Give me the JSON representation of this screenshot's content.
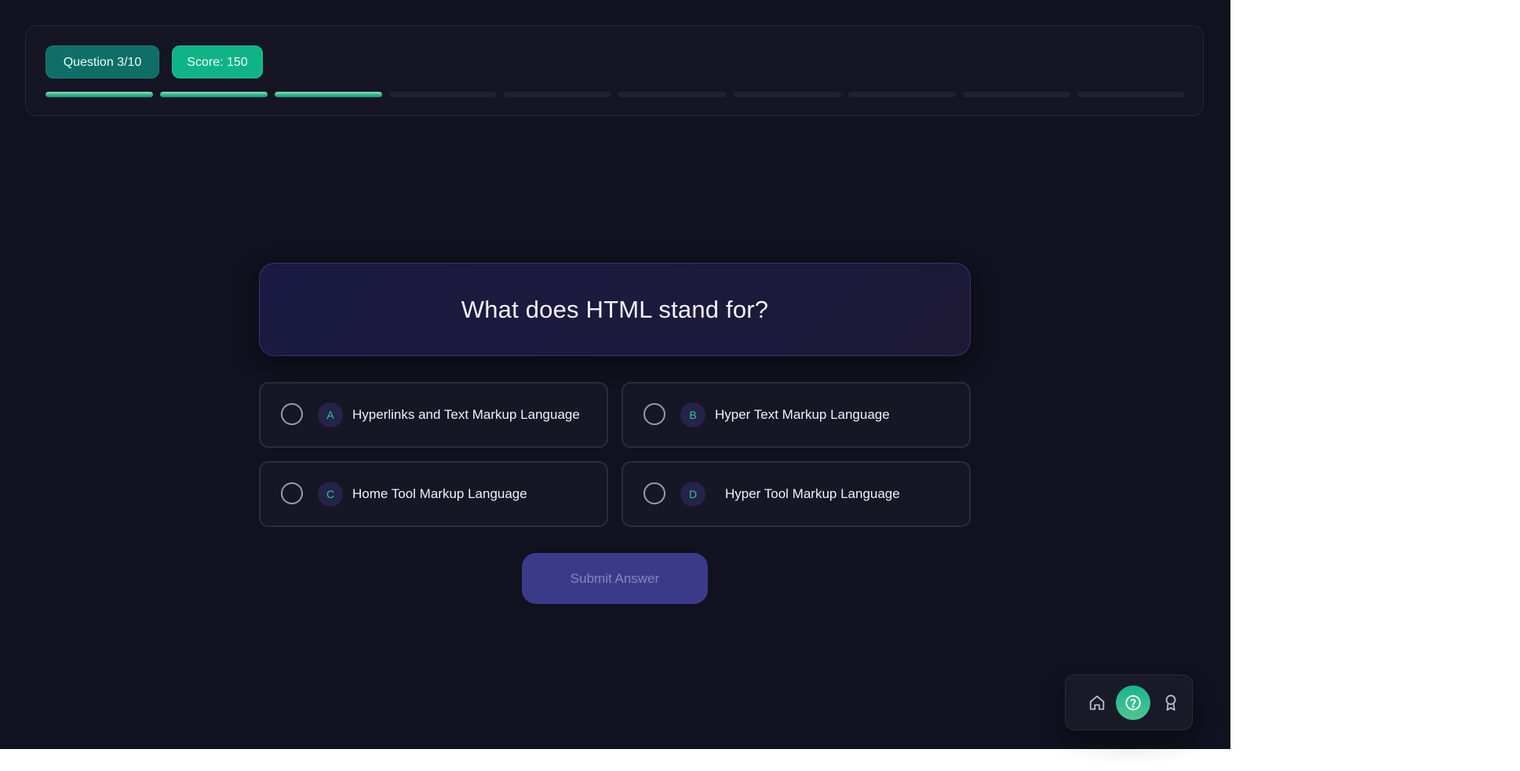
{
  "header": {
    "question_badge": "Question 3/10",
    "score_badge": "Score: 150",
    "progress": {
      "completed": 3,
      "total": 10
    }
  },
  "question": {
    "text": "What does HTML stand for?"
  },
  "options": [
    {
      "letter": "A",
      "text": "Hyperlinks and Text Markup Language"
    },
    {
      "letter": "B",
      "text": "Hyper Text Markup Language"
    },
    {
      "letter": "C",
      "text": "Home Tool Markup Language"
    },
    {
      "letter": "D",
      "text": "Hyper Tool Markup Language"
    }
  ],
  "submit": {
    "label": "Submit Answer"
  },
  "nav": {
    "items": [
      {
        "icon": "home-icon"
      },
      {
        "icon": "help-circle-icon",
        "active": true
      },
      {
        "icon": "award-icon"
      }
    ]
  },
  "colors": {
    "background": "#11111f",
    "accent": "#10b386",
    "question_badge": "#0f6e68",
    "submit": "#3b3a8a",
    "letter_text": "#2bc9a4"
  }
}
